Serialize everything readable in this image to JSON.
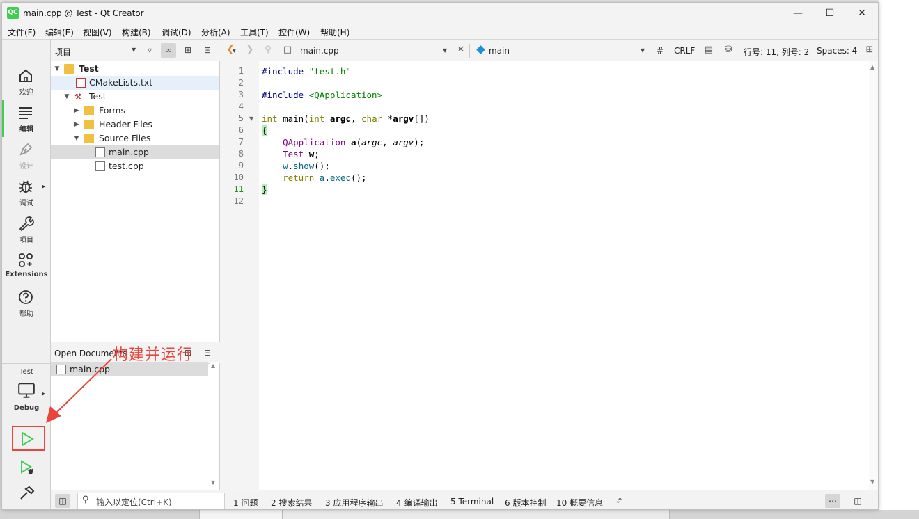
{
  "window": {
    "title": "main.cpp @ Test - Qt Creator",
    "logo": "QC"
  },
  "menu": [
    "文件(F)",
    "编辑(E)",
    "视图(V)",
    "构建(B)",
    "调试(D)",
    "分析(A)",
    "工具(T)",
    "控件(W)",
    "帮助(H)"
  ],
  "modes": [
    {
      "label": "欢迎",
      "icon": "home-icon"
    },
    {
      "label": "编辑",
      "icon": "edit-icon"
    },
    {
      "label": "设计",
      "icon": "pen-icon"
    },
    {
      "label": "调试",
      "icon": "bug-icon"
    },
    {
      "label": "项目",
      "icon": "wrench-icon"
    },
    {
      "label": "Extensions",
      "icon": "extensions-icon"
    },
    {
      "label": "帮助",
      "icon": "help-icon"
    }
  ],
  "kit": {
    "project": "Test",
    "config": "Debug"
  },
  "projects_pane": {
    "title": "项目"
  },
  "tree": {
    "root": "Test",
    "cmake": "CMakeLists.txt",
    "target": "Test",
    "forms": "Forms",
    "headers": "Header Files",
    "sources": "Source Files",
    "main": "main.cpp",
    "test": "test.cpp"
  },
  "open_docs": {
    "title": "Open Documents",
    "file": "main.cpp"
  },
  "editor_bar": {
    "file": "main.cpp",
    "symbol": "main",
    "hash": "#",
    "eol": "CRLF",
    "position": "行号: 11, 列号: 2",
    "spaces": "Spaces: 4"
  },
  "code_lines": [
    "1",
    "2",
    "3",
    "4",
    "5",
    "6",
    "7",
    "8",
    "9",
    "10",
    "11",
    "12"
  ],
  "status": {
    "locator_placeholder": "输入以定位(Ctrl+K)",
    "tabs": [
      "1  问题",
      "2  搜索结果",
      "3  应用程序输出",
      "4  编译输出",
      "5  Terminal",
      "6  版本控制",
      "10  概要信息"
    ]
  },
  "annotation": "构建并运行",
  "colors": {
    "accent": "#41cd52",
    "annotation": "#e8463c"
  }
}
